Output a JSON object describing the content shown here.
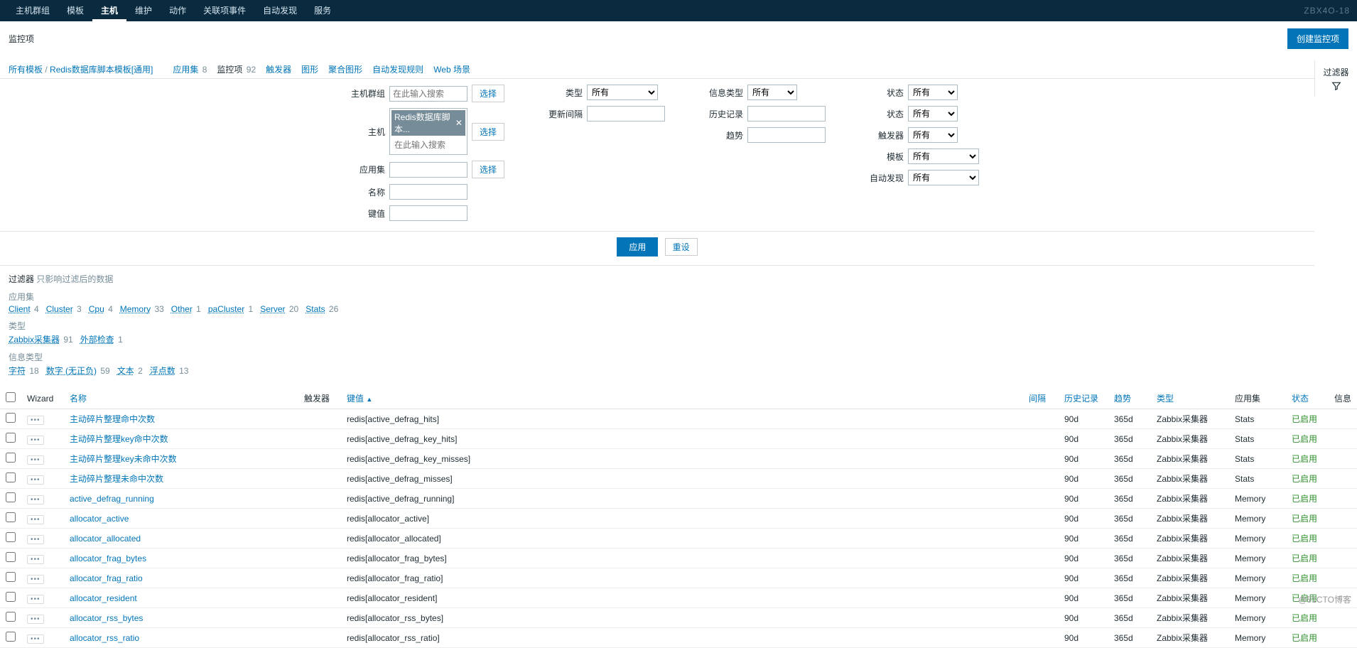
{
  "brand": "ZBX4O-18",
  "nav": [
    "主机群组",
    "模板",
    "主机",
    "维护",
    "动作",
    "关联项事件",
    "自动发现",
    "服务"
  ],
  "nav_active_index": 2,
  "page_title": "监控项",
  "create_button": "创建监控项",
  "filter_toggle": "过滤器",
  "breadcrumb": {
    "all_templates": "所有模板",
    "sep": " / ",
    "template": "Redis数据库脚本模板[通用]"
  },
  "subnav": [
    {
      "label": "应用集",
      "count": "8"
    },
    {
      "label": "监控项",
      "count": "92",
      "active": true
    },
    {
      "label": "触发器",
      "count": ""
    },
    {
      "label": "图形",
      "count": ""
    },
    {
      "label": "聚合图形",
      "count": ""
    },
    {
      "label": "自动发现规则",
      "count": ""
    },
    {
      "label": "Web 场景",
      "count": ""
    }
  ],
  "filter": {
    "labels": {
      "hostgroup": "主机群组",
      "host": "主机",
      "appset": "应用集",
      "name": "名称",
      "key": "键值",
      "type": "类型",
      "interval": "更新间隔",
      "infotype": "信息类型",
      "history": "历史记录",
      "trends": "趋势",
      "state": "状态",
      "status": "状态",
      "triggers": "触发器",
      "template": "模板",
      "discovery": "自动发现"
    },
    "placeholder": "在此输入搜索",
    "host_tag": "Redis数据库脚本...",
    "select_btn": "选择",
    "all": "所有",
    "apply": "应用",
    "reset": "重设"
  },
  "hint": {
    "prefix": "过滤器",
    "text": "只影响过滤后的数据"
  },
  "facets": {
    "appset": {
      "label": "应用集",
      "items": [
        {
          "name": "Client",
          "count": "4"
        },
        {
          "name": "Cluster",
          "count": "3"
        },
        {
          "name": "Cpu",
          "count": "4"
        },
        {
          "name": "Memory",
          "count": "33"
        },
        {
          "name": "Other",
          "count": "1"
        },
        {
          "name": "paCluster",
          "count": "1"
        },
        {
          "name": "Server",
          "count": "20"
        },
        {
          "name": "Stats",
          "count": "26"
        }
      ]
    },
    "type": {
      "label": "类型",
      "items": [
        {
          "name": "Zabbix采集器",
          "count": "91"
        },
        {
          "name": "外部检查",
          "count": "1"
        }
      ]
    },
    "infotype": {
      "label": "信息类型",
      "items": [
        {
          "name": "字符",
          "count": "18"
        },
        {
          "name": "数字 (无正负)",
          "count": "59"
        },
        {
          "name": "文本",
          "count": "2"
        },
        {
          "name": "浮点数",
          "count": "13"
        }
      ]
    }
  },
  "table": {
    "headers": {
      "wizard": "Wizard",
      "name": "名称",
      "triggers": "触发器",
      "key": "键值",
      "interval": "间隔",
      "history": "历史记录",
      "trends": "趋势",
      "type": "类型",
      "appset": "应用集",
      "status": "状态",
      "info": "信息"
    },
    "sort_indicator": "▲",
    "rows": [
      {
        "name": "主动碎片整理命中次数",
        "key": "redis[active_defrag_hits]",
        "history": "90d",
        "trends": "365d",
        "type": "Zabbix采集器",
        "appset": "Stats",
        "status": "已启用"
      },
      {
        "name": "主动碎片整理key命中次数",
        "key": "redis[active_defrag_key_hits]",
        "history": "90d",
        "trends": "365d",
        "type": "Zabbix采集器",
        "appset": "Stats",
        "status": "已启用"
      },
      {
        "name": "主动碎片整理key未命中次数",
        "key": "redis[active_defrag_key_misses]",
        "history": "90d",
        "trends": "365d",
        "type": "Zabbix采集器",
        "appset": "Stats",
        "status": "已启用"
      },
      {
        "name": "主动碎片整理未命中次数",
        "key": "redis[active_defrag_misses]",
        "history": "90d",
        "trends": "365d",
        "type": "Zabbix采集器",
        "appset": "Stats",
        "status": "已启用"
      },
      {
        "name": "active_defrag_running",
        "key": "redis[active_defrag_running]",
        "history": "90d",
        "trends": "365d",
        "type": "Zabbix采集器",
        "appset": "Memory",
        "status": "已启用"
      },
      {
        "name": "allocator_active",
        "key": "redis[allocator_active]",
        "history": "90d",
        "trends": "365d",
        "type": "Zabbix采集器",
        "appset": "Memory",
        "status": "已启用"
      },
      {
        "name": "allocator_allocated",
        "key": "redis[allocator_allocated]",
        "history": "90d",
        "trends": "365d",
        "type": "Zabbix采集器",
        "appset": "Memory",
        "status": "已启用"
      },
      {
        "name": "allocator_frag_bytes",
        "key": "redis[allocator_frag_bytes]",
        "history": "90d",
        "trends": "365d",
        "type": "Zabbix采集器",
        "appset": "Memory",
        "status": "已启用"
      },
      {
        "name": "allocator_frag_ratio",
        "key": "redis[allocator_frag_ratio]",
        "history": "90d",
        "trends": "365d",
        "type": "Zabbix采集器",
        "appset": "Memory",
        "status": "已启用"
      },
      {
        "name": "allocator_resident",
        "key": "redis[allocator_resident]",
        "history": "90d",
        "trends": "365d",
        "type": "Zabbix采集器",
        "appset": "Memory",
        "status": "已启用"
      },
      {
        "name": "allocator_rss_bytes",
        "key": "redis[allocator_rss_bytes]",
        "history": "90d",
        "trends": "365d",
        "type": "Zabbix采集器",
        "appset": "Memory",
        "status": "已启用"
      },
      {
        "name": "allocator_rss_ratio",
        "key": "redis[allocator_rss_ratio]",
        "history": "90d",
        "trends": "365d",
        "type": "Zabbix采集器",
        "appset": "Memory",
        "status": "已启用"
      }
    ]
  },
  "watermark": "@51CTO博客"
}
